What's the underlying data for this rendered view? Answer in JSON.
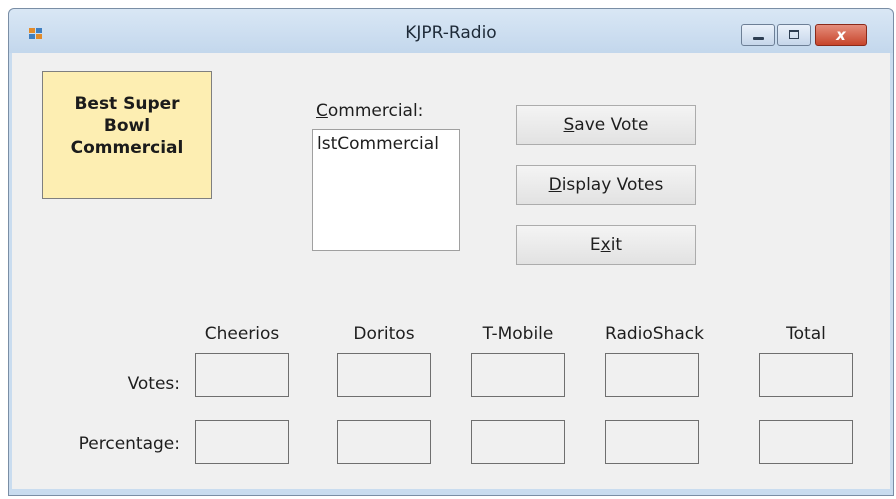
{
  "window": {
    "title": "KJPR-Radio",
    "close_glyph": "x"
  },
  "heading": {
    "text": "Best Super Bowl Commercial"
  },
  "commercial": {
    "label_key": "C",
    "label_rest": "ommercial:",
    "listbox_item": "lstCommercial"
  },
  "buttons": {
    "save_key": "S",
    "save_rest": "ave Vote",
    "display_key": "D",
    "display_rest": "isplay Votes",
    "exit_pre": "E",
    "exit_key": "x",
    "exit_post": "it"
  },
  "columns": [
    "Cheerios",
    "Doritos",
    "T-Mobile",
    "RadioShack",
    "Total"
  ],
  "rows": {
    "votes_label": "Votes:",
    "percentage_label": "Percentage:"
  },
  "icons": {
    "app": "app-icon",
    "minimize": "minimize-icon",
    "maximize": "maximize-icon",
    "close": "close-icon"
  },
  "colors": {
    "heading_background": "#fdeeb2",
    "form_background": "#f0f0f0",
    "close_button": "#c7452b"
  }
}
